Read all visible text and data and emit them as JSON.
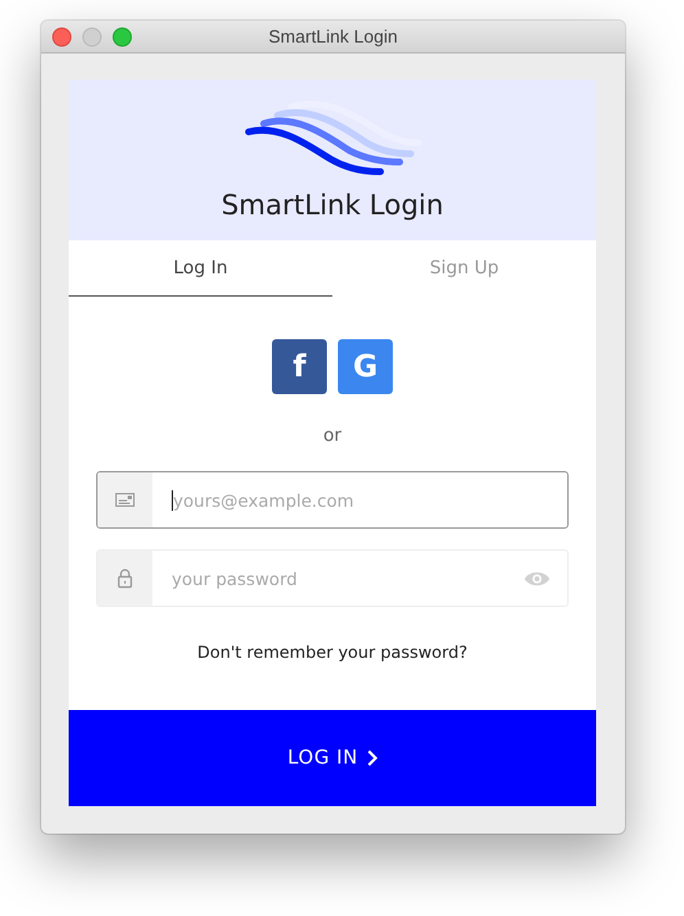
{
  "window": {
    "title": "SmartLink Login"
  },
  "header": {
    "title": "SmartLink Login"
  },
  "tabs": [
    {
      "label": "Log In",
      "selected": true
    },
    {
      "label": "Sign Up",
      "selected": false
    }
  ],
  "social_buttons": [
    {
      "label": "f",
      "color": "#355899"
    },
    {
      "label": "G",
      "color": "#3b87ef"
    }
  ],
  "separator": "or",
  "fields": [
    {
      "kind": "email",
      "placeholder": "yours@example.com",
      "focused": true
    },
    {
      "kind": "password",
      "placeholder": "your password",
      "focused": false
    }
  ],
  "forgot_link": "Don't remember your password?",
  "submit_button": "LOG IN"
}
